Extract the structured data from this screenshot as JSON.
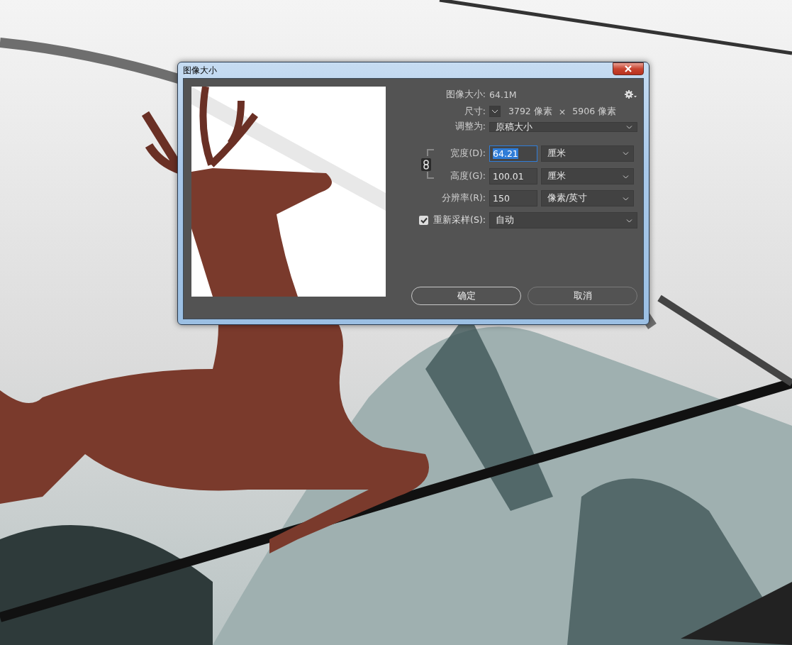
{
  "window": {
    "title": "图像大小"
  },
  "image_size": {
    "label": "图像大小:",
    "value": "64.1M"
  },
  "dimensions": {
    "label": "尺寸:",
    "width": "3792 像素",
    "times": "×",
    "height": "5906 像素"
  },
  "fit_to": {
    "label": "调整为:",
    "value": "原稿大小"
  },
  "constrain": {
    "linked": true
  },
  "fields": [
    {
      "label": "宽度(D):",
      "value": "64.21",
      "focused": true,
      "unit": "厘米"
    },
    {
      "label": "高度(G):",
      "value": "100.01",
      "focused": false,
      "unit": "厘米"
    },
    {
      "label": "分辨率(R):",
      "value": "150",
      "focused": false,
      "unit": "像素/英寸"
    }
  ],
  "resample": {
    "checked": true,
    "label": "重新采样(S):",
    "value": "自动"
  },
  "buttons": [
    {
      "label": "确定",
      "default": true
    },
    {
      "label": "取消",
      "default": false
    }
  ]
}
